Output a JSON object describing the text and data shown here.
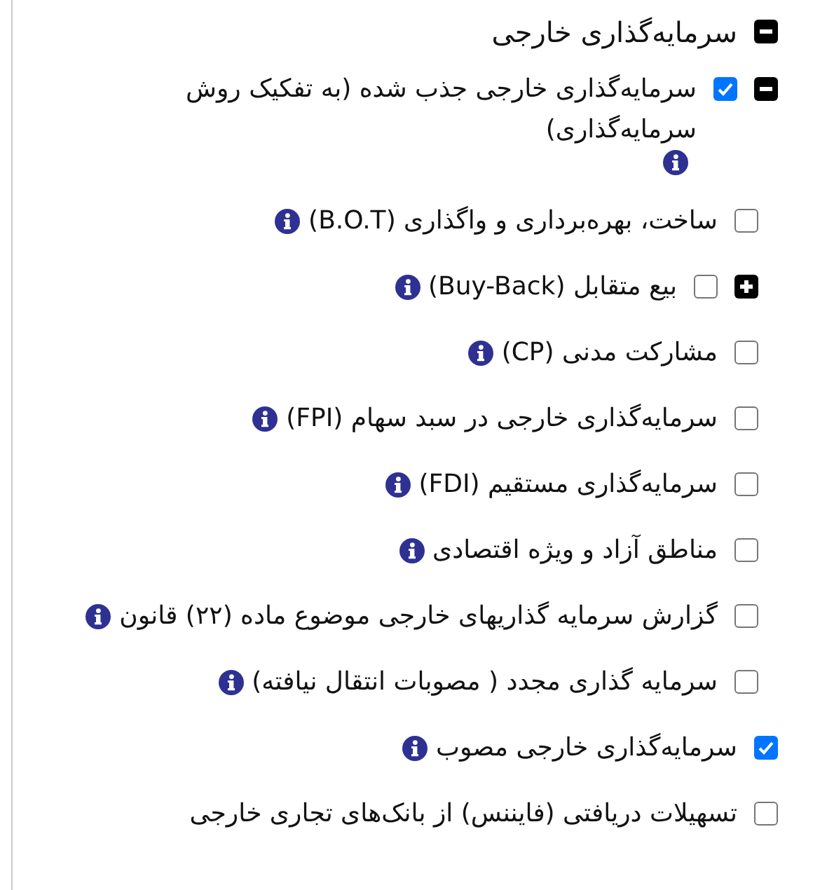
{
  "tree": {
    "label": "سرمایه‌گذاری خارجی",
    "expanded": true,
    "children": [
      {
        "label": "سرمایه‌گذاری خارجی جذب شده (به تفکیک روش سرمایه‌گذاری)",
        "expanded": true,
        "checked": true,
        "info": true,
        "children": [
          {
            "label": "ساخت، بهره‌برداری و واگذاری (B.O.T)",
            "checked": false,
            "info": true
          },
          {
            "label": "بیع متقابل (Buy-Back)",
            "expanded": false,
            "checked": false,
            "info": true
          },
          {
            "label": "مشارکت مدنی (CP)",
            "checked": false,
            "info": true
          },
          {
            "label": "سرمایه‌گذاری خارجی در سبد سهام (FPI)",
            "checked": false,
            "info": true
          },
          {
            "label": "سرمایه‌گذاری مستقیم (FDI)",
            "checked": false,
            "info": true
          },
          {
            "label": "مناطق آزاد و ویژه اقتصادی",
            "checked": false,
            "info": true
          },
          {
            "label": "گزارش سرمایه گذاریهای خارجی موضوع ماده (۲۲) قانون",
            "checked": false,
            "info": true
          },
          {
            "label": "سرمایه گذاری مجدد ( مصوبات انتقال نیافته)",
            "checked": false,
            "info": true
          }
        ]
      },
      {
        "label": "سرمایه‌گذاری خارجی مصوب",
        "checked": true,
        "info": true
      },
      {
        "label": "تسهیلات دریافتی (فایننس) از بانک‌های تجاری خارجی",
        "checked": false,
        "info": false
      }
    ]
  }
}
